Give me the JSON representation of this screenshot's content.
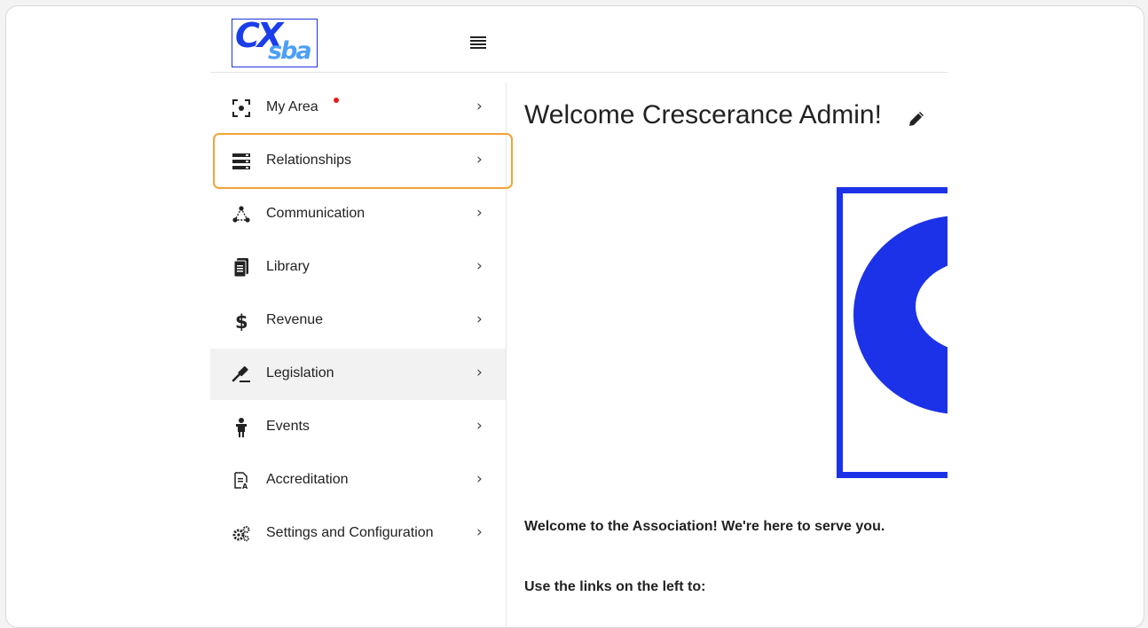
{
  "logo": {
    "main_text": "CX",
    "sub_text": "sba"
  },
  "sidebar": {
    "items": [
      {
        "label": "My Area",
        "icon": "focus-target-icon",
        "chevron": "›"
      },
      {
        "label": "Relationships",
        "icon": "storage-list-icon",
        "chevron": "›"
      },
      {
        "label": "Communication",
        "icon": "network-triangle-icon",
        "chevron": "›"
      },
      {
        "label": "Library",
        "icon": "document-stack-icon",
        "chevron": "›"
      },
      {
        "label": "Revenue",
        "icon": "dollar-icon",
        "chevron": "›"
      },
      {
        "label": "Legislation",
        "icon": "gavel-icon",
        "chevron": "›"
      },
      {
        "label": "Events",
        "icon": "person-podium-icon",
        "chevron": "›"
      },
      {
        "label": "Accreditation",
        "icon": "document-certificate-icon",
        "chevron": "›"
      },
      {
        "label": "Settings and Configuration",
        "icon": "gears-icon",
        "chevron": "›"
      }
    ],
    "active_item": "Legislation",
    "highlighted_item": "Relationships"
  },
  "main": {
    "title": "Welcome Crescerance Admin!",
    "intro": "Welcome to the Association!  We're here to serve you.",
    "links_intro": "Use the links on the left to:"
  },
  "colors": {
    "brand_blue": "#1c32e8",
    "logo_light_blue": "#4d9ff7",
    "highlight_orange": "#f2a43a",
    "notification_red": "#e81b1b"
  }
}
